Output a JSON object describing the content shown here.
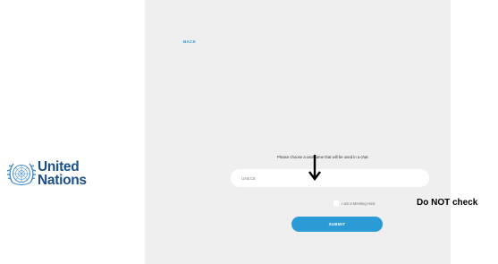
{
  "logo": {
    "line1": "United",
    "line2": "Nations",
    "icon": "un-emblem-icon",
    "color": "#1a4f8a"
  },
  "form": {
    "back_label": "BACK",
    "prompt": "Please choose a username that will be used in a chat",
    "username_value": "UNECE",
    "host_checkbox_label": "I am a Meeting Host",
    "host_checked": false,
    "submit_label": "SUBMIT"
  },
  "annotation": {
    "text": "Do NOT check",
    "arrow_icon": "down-arrow-icon"
  },
  "colors": {
    "accent": "#2b9bd6",
    "panel_background": "#efefef"
  }
}
